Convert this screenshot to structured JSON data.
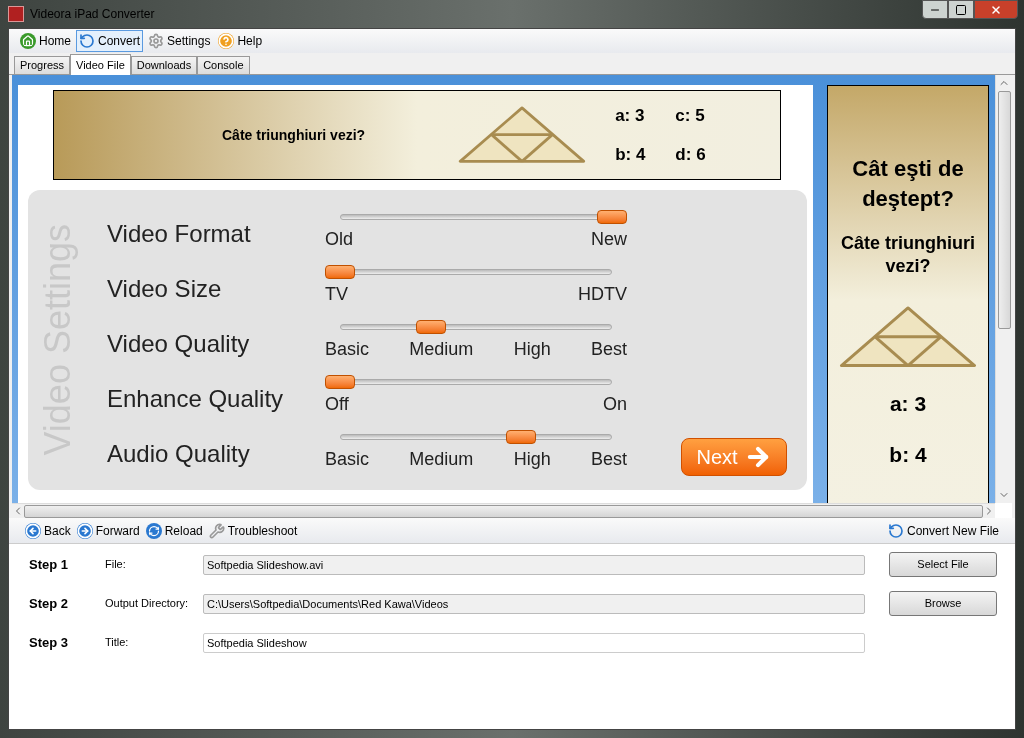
{
  "window": {
    "title": "Videora iPad Converter"
  },
  "toolbar": [
    {
      "label": "Home",
      "kind": "home",
      "selected": false
    },
    {
      "label": "Convert",
      "kind": "convert",
      "selected": true
    },
    {
      "label": "Settings",
      "kind": "settings",
      "selected": false
    },
    {
      "label": "Help",
      "kind": "help",
      "selected": false
    }
  ],
  "tabs": [
    {
      "label": "Progress",
      "selected": false
    },
    {
      "label": "Video File",
      "selected": true
    },
    {
      "label": "Downloads",
      "selected": false
    },
    {
      "label": "Console",
      "selected": false
    }
  ],
  "banner_top": {
    "question": "Câte triunghiuri vezi?",
    "answers": [
      "a: 3",
      "c: 5",
      "b: 4",
      "d: 6"
    ]
  },
  "video_settings": {
    "title": "Video Settings",
    "rows": [
      {
        "label": "Video Format",
        "stops": [
          "Old",
          "New"
        ],
        "level": 1
      },
      {
        "label": "Video Size",
        "stops": [
          "TV",
          "HDTV"
        ],
        "level": 0
      },
      {
        "label": "Video Quality",
        "stops": [
          "Basic",
          "Medium",
          "High",
          "Best"
        ],
        "level": 0.333
      },
      {
        "label": "Enhance Quality",
        "stops": [
          "Off",
          "On"
        ],
        "level": 0
      },
      {
        "label": "Audio Quality",
        "stops": [
          "Basic",
          "Medium",
          "High",
          "Best"
        ],
        "level": 0.667
      }
    ],
    "next_button": "Next"
  },
  "banner_side": {
    "title": "Cât eşti de deştept?",
    "question": "Câte triunghiuri vezi?",
    "answers": [
      "a: 3",
      "b: 4"
    ]
  },
  "nav_toolbar": [
    {
      "label": "Back",
      "kind": "back"
    },
    {
      "label": "Forward",
      "kind": "forward"
    },
    {
      "label": "Reload",
      "kind": "reload"
    },
    {
      "label": "Troubleshoot",
      "kind": "wrench"
    }
  ],
  "convert_new_file": "Convert New File",
  "steps": [
    {
      "step": "Step 1",
      "label": "File:",
      "value": "Softpedia Slideshow.avi",
      "readonly": true,
      "button": "Select File"
    },
    {
      "step": "Step 2",
      "label": "Output Directory:",
      "value": "C:\\Users\\Softpedia\\Documents\\Red Kawa\\Videos",
      "readonly": true,
      "button": "Browse"
    },
    {
      "step": "Step 3",
      "label": "Title:",
      "value": "Softpedia Slideshow",
      "readonly": false
    }
  ]
}
